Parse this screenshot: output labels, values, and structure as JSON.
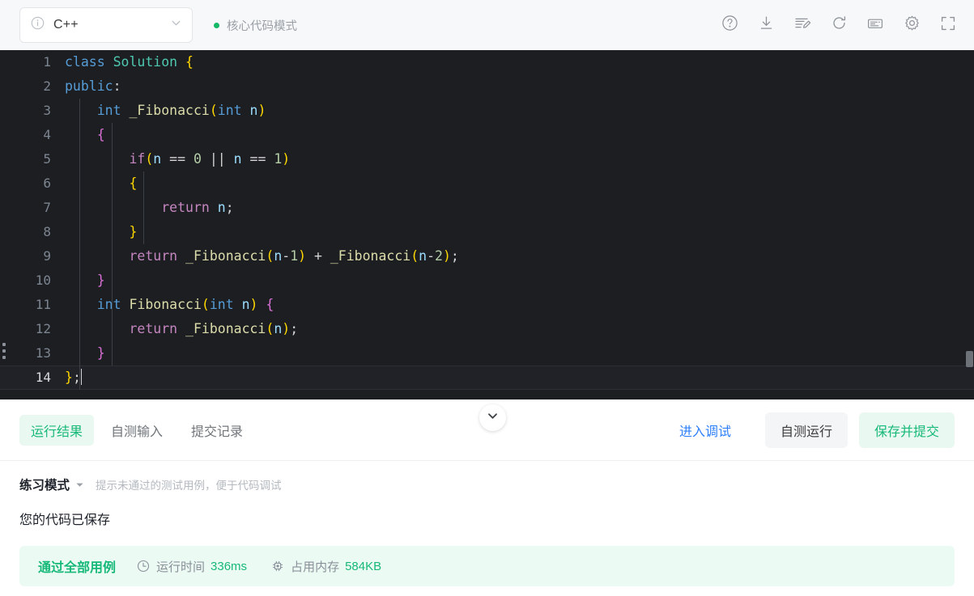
{
  "toolbar": {
    "language": {
      "value": "C++",
      "info_icon": "info-circle-icon",
      "chevron_icon": "chevron-down-icon"
    },
    "mode_indicator": {
      "label": "核心代码模式",
      "dot_color": "#14b866"
    },
    "icons": [
      {
        "name": "help-icon",
        "title": "帮助"
      },
      {
        "name": "download-icon",
        "title": "下载"
      },
      {
        "name": "format-code-icon",
        "title": "格式化代码"
      },
      {
        "name": "reset-icon",
        "title": "重置代码"
      },
      {
        "name": "keyboard-icon",
        "title": "快捷键"
      },
      {
        "name": "settings-icon",
        "title": "设置"
      },
      {
        "name": "fullscreen-icon",
        "title": "全屏"
      }
    ]
  },
  "editor": {
    "active_line": 14,
    "collapse_icon": "chevron-down-icon",
    "drag_handle_icon": "drag-dots-icon",
    "scrollbar_icon": "vertical-scrollbar",
    "lines": [
      {
        "n": "1",
        "indent": 0,
        "tokens": [
          {
            "t": "class",
            "c": "t-kw"
          },
          {
            "t": " ",
            "c": "t-plain"
          },
          {
            "t": "Solution",
            "c": "t-type"
          },
          {
            "t": " ",
            "c": "t-plain"
          },
          {
            "t": "{",
            "c": "t-br1"
          }
        ]
      },
      {
        "n": "2",
        "indent": 0,
        "tokens": [
          {
            "t": "public",
            "c": "t-kw"
          },
          {
            "t": ":",
            "c": "t-plain"
          }
        ]
      },
      {
        "n": "3",
        "indent": 1,
        "tokens": [
          {
            "t": "    ",
            "c": "t-plain"
          },
          {
            "t": "int",
            "c": "t-kw"
          },
          {
            "t": " _Fibonacci",
            "c": "t-fn"
          },
          {
            "t": "(",
            "c": "t-br1"
          },
          {
            "t": "int",
            "c": "t-kw"
          },
          {
            "t": " ",
            "c": "t-plain"
          },
          {
            "t": "n",
            "c": "t-var"
          },
          {
            "t": ")",
            "c": "t-br1"
          }
        ]
      },
      {
        "n": "4",
        "indent": 1,
        "tokens": [
          {
            "t": "    ",
            "c": "t-plain"
          },
          {
            "t": "{",
            "c": "t-br2"
          }
        ]
      },
      {
        "n": "5",
        "indent": 2,
        "tokens": [
          {
            "t": "        ",
            "c": "t-plain"
          },
          {
            "t": "if",
            "c": "t-ctl"
          },
          {
            "t": "(",
            "c": "t-br1"
          },
          {
            "t": "n",
            "c": "t-var"
          },
          {
            "t": " == ",
            "c": "t-plain"
          },
          {
            "t": "0",
            "c": "t-num"
          },
          {
            "t": " || ",
            "c": "t-plain"
          },
          {
            "t": "n",
            "c": "t-var"
          },
          {
            "t": " == ",
            "c": "t-plain"
          },
          {
            "t": "1",
            "c": "t-num"
          },
          {
            "t": ")",
            "c": "t-br1"
          }
        ]
      },
      {
        "n": "6",
        "indent": 2,
        "tokens": [
          {
            "t": "        ",
            "c": "t-plain"
          },
          {
            "t": "{",
            "c": "t-br1"
          }
        ]
      },
      {
        "n": "7",
        "indent": 3,
        "tokens": [
          {
            "t": "            ",
            "c": "t-plain"
          },
          {
            "t": "return",
            "c": "t-ctl"
          },
          {
            "t": " ",
            "c": "t-plain"
          },
          {
            "t": "n",
            "c": "t-var"
          },
          {
            "t": ";",
            "c": "t-plain"
          }
        ]
      },
      {
        "n": "8",
        "indent": 2,
        "tokens": [
          {
            "t": "        ",
            "c": "t-plain"
          },
          {
            "t": "}",
            "c": "t-br1"
          }
        ]
      },
      {
        "n": "9",
        "indent": 2,
        "tokens": [
          {
            "t": "        ",
            "c": "t-plain"
          },
          {
            "t": "return",
            "c": "t-ctl"
          },
          {
            "t": " _Fibonacci",
            "c": "t-fn"
          },
          {
            "t": "(",
            "c": "t-br1"
          },
          {
            "t": "n",
            "c": "t-var"
          },
          {
            "t": "-",
            "c": "t-plain"
          },
          {
            "t": "1",
            "c": "t-num"
          },
          {
            "t": ")",
            "c": "t-br1"
          },
          {
            "t": " + ",
            "c": "t-plain"
          },
          {
            "t": "_Fibonacci",
            "c": "t-fn"
          },
          {
            "t": "(",
            "c": "t-br1"
          },
          {
            "t": "n",
            "c": "t-var"
          },
          {
            "t": "-",
            "c": "t-plain"
          },
          {
            "t": "2",
            "c": "t-num"
          },
          {
            "t": ")",
            "c": "t-br1"
          },
          {
            "t": ";",
            "c": "t-plain"
          }
        ]
      },
      {
        "n": "10",
        "indent": 1,
        "tokens": [
          {
            "t": "    ",
            "c": "t-plain"
          },
          {
            "t": "}",
            "c": "t-br2"
          }
        ]
      },
      {
        "n": "11",
        "indent": 1,
        "tokens": [
          {
            "t": "    ",
            "c": "t-plain"
          },
          {
            "t": "int",
            "c": "t-kw"
          },
          {
            "t": " Fibonacci",
            "c": "t-fn"
          },
          {
            "t": "(",
            "c": "t-br1"
          },
          {
            "t": "int",
            "c": "t-kw"
          },
          {
            "t": " ",
            "c": "t-plain"
          },
          {
            "t": "n",
            "c": "t-var"
          },
          {
            "t": ")",
            "c": "t-br1"
          },
          {
            "t": " ",
            "c": "t-plain"
          },
          {
            "t": "{",
            "c": "t-br2"
          }
        ]
      },
      {
        "n": "12",
        "indent": 2,
        "tokens": [
          {
            "t": "        ",
            "c": "t-plain"
          },
          {
            "t": "return",
            "c": "t-ctl"
          },
          {
            "t": " _Fibonacci",
            "c": "t-fn"
          },
          {
            "t": "(",
            "c": "t-br1"
          },
          {
            "t": "n",
            "c": "t-var"
          },
          {
            "t": ")",
            "c": "t-br1"
          },
          {
            "t": ";",
            "c": "t-plain"
          }
        ]
      },
      {
        "n": "13",
        "indent": 1,
        "tokens": [
          {
            "t": "    ",
            "c": "t-plain"
          },
          {
            "t": "}",
            "c": "t-br2"
          }
        ]
      },
      {
        "n": "14",
        "indent": 0,
        "tokens": [
          {
            "t": "}",
            "c": "t-br1"
          },
          {
            "t": ";",
            "c": "t-plain"
          }
        ],
        "caret": true
      }
    ]
  },
  "console": {
    "tabs": [
      {
        "label": "运行结果",
        "active": true
      },
      {
        "label": "自测输入",
        "active": false
      },
      {
        "label": "提交记录",
        "active": false
      }
    ],
    "debug_link": "进入调试",
    "run_button": "自测运行",
    "submit_button": "保存并提交",
    "practice_mode": {
      "label": "练习模式",
      "caret_icon": "caret-down-icon",
      "hint": "提示未通过的测试用例，便于代码调试"
    },
    "saved_message": "您的代码已保存",
    "result": {
      "title": "通过全部用例",
      "metrics": [
        {
          "icon": "clock-icon",
          "label": "运行时间",
          "value": "336ms"
        },
        {
          "icon": "memory-chip-icon",
          "label": "占用内存",
          "value": "584KB"
        }
      ],
      "background": "#ebfaf3",
      "accent": "#17b978"
    }
  }
}
